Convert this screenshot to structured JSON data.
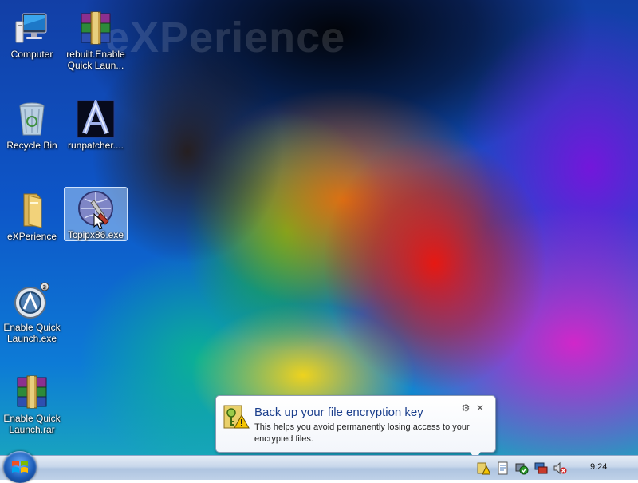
{
  "wallpaper": {
    "text": "eXPerience"
  },
  "desktop_icons": [
    {
      "label": "Computer",
      "icon": "computer-icon"
    },
    {
      "label": "rebuilt.Enable Quick Laun...",
      "icon": "winrar-archive-icon"
    },
    {
      "label": "Recycle Bin",
      "icon": "recycle-bin-icon"
    },
    {
      "label": "runpatcher....",
      "icon": "runpatcher-icon"
    },
    {
      "label": "eXPerience",
      "icon": "folder-icon"
    },
    {
      "label": "Tcpipx86.exe",
      "icon": "tcpip-patcher-icon",
      "selected": true
    },
    {
      "label": "Enable Quick Launch.exe",
      "icon": "quick-launch-app-icon"
    },
    {
      "label": "Enable Quick Launch.rar",
      "icon": "winrar-archive-icon"
    }
  ],
  "balloon": {
    "title": "Back up your file encryption key",
    "body": "This helps you avoid permanently losing access to your encrypted files.",
    "icon": "encryption-key-warning-icon",
    "options_glyph": "⚙",
    "close_glyph": "✕"
  },
  "taskbar": {
    "start_icon": "windows-logo-icon",
    "tray_icons": [
      "warning-key-icon",
      "document-icon",
      "security-check-icon",
      "network-icon",
      "volume-muted-icon"
    ],
    "clock": "9:24"
  },
  "colors": {
    "balloon_title": "#1a3e8c",
    "taskbar_top": "#e6edf6",
    "taskbar_bottom": "#aec4e0",
    "selection": "#aacdf5"
  }
}
